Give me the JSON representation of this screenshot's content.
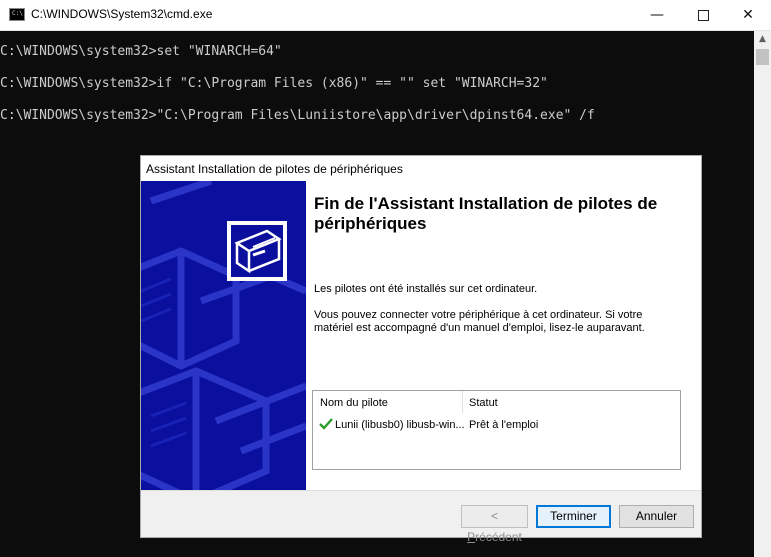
{
  "cmd": {
    "icon_text": "C:\\",
    "title": "C:\\WINDOWS\\System32\\cmd.exe",
    "lines": [
      "C:\\WINDOWS\\system32>set \"WINARCH=64\"",
      "C:\\WINDOWS\\system32>if \"C:\\Program Files (x86)\" == \"\" set \"WINARCH=32\"",
      "C:\\WINDOWS\\system32>\"C:\\Program Files\\Luniistore\\app\\driver\\dpinst64.exe\" /f"
    ]
  },
  "dialog": {
    "title": "Assistant Installation de pilotes de périphériques",
    "heading": "Fin de l'Assistant Installation de pilotes de périphériques",
    "para1": "Les pilotes ont été installés sur cet ordinateur.",
    "para2": "Vous pouvez connecter votre périphérique à cet ordinateur. Si votre matériel est accompagné d'un manuel d'emploi, lisez-le auparavant.",
    "table": {
      "headers": [
        "Nom du pilote",
        "Statut"
      ],
      "rows": [
        {
          "name": "Lunii (libusb0) libusb-win...",
          "status": "Prêt à l'emploi",
          "icon": "check-icon"
        }
      ]
    },
    "buttons": {
      "previous_accel": "P",
      "previous_rest": "récédent",
      "previous_prefix": "< ",
      "finish": "Terminer",
      "cancel": "Annuler"
    }
  },
  "colors": {
    "console_bg": "#0c0c0c",
    "console_text": "#cccccc",
    "banner": "#0b0f9e",
    "check": "#2a9d2a",
    "focus_border": "#0078d7"
  }
}
